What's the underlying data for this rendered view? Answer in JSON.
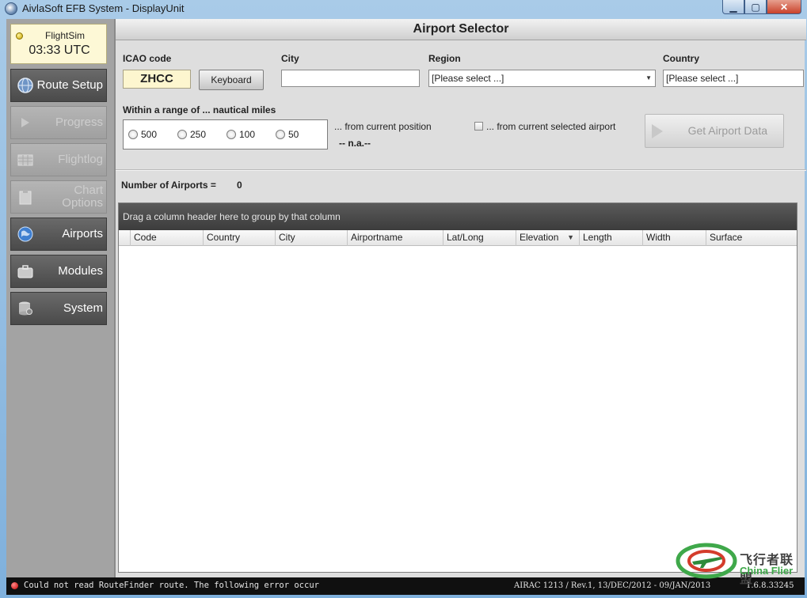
{
  "window": {
    "title": "AivlaSoft EFB System - DisplayUnit",
    "min_label": "▁",
    "max_label": "▢",
    "close_label": "✕"
  },
  "sidebar": {
    "sim_name": "FlightSim",
    "sim_time": "03:33 UTC",
    "items": [
      {
        "label": "Route Setup",
        "enabled": true,
        "icon": "globe-icon"
      },
      {
        "label": "Progress",
        "enabled": false,
        "icon": "play-icon"
      },
      {
        "label": "Flightlog",
        "enabled": false,
        "icon": "grid-icon"
      },
      {
        "label": "Chart Options",
        "enabled": false,
        "icon": "clipboard-icon"
      },
      {
        "label": "Airports",
        "enabled": true,
        "icon": "earth-icon"
      },
      {
        "label": "Modules",
        "enabled": true,
        "icon": "briefcase-icon"
      },
      {
        "label": "System",
        "enabled": true,
        "icon": "database-icon"
      }
    ]
  },
  "main": {
    "title": "Airport Selector",
    "icao_label": "ICAO code",
    "icao_value": "ZHCC",
    "keyboard_label": "Keyboard",
    "city_label": "City",
    "city_value": "",
    "region_label": "Region",
    "region_value": "[Please select ...]",
    "country_label": "Country",
    "country_value": "[Please select ...]",
    "range_label": "Within a range of ... nautical miles",
    "range_options": [
      "500",
      "250",
      "100",
      "50"
    ],
    "from_position_label": "... from current position",
    "position_value": "-- n.a.--",
    "from_airport_label": "... from current selected airport",
    "get_data_label": "Get Airport Data",
    "num_airports_label": "Number of Airports =",
    "num_airports_value": "0"
  },
  "grid": {
    "group_hint": "Drag a column header here to group by that column",
    "columns": [
      "Code",
      "Country",
      "City",
      "Airportname",
      "Lat/Long",
      "Elevation",
      "Length",
      "Width",
      "Surface"
    ],
    "sort_indicator": "▼"
  },
  "status": {
    "message": "Could not read RouteFinder route. The following error occur",
    "airac": "AIRAC 1213 / Rev.1, 13/DEC/2012 - 09/JAN/2013",
    "version": "1.6.8.33245"
  },
  "watermark": {
    "cn": "飞行者联盟",
    "en": "China Flier"
  },
  "colors": {
    "status_led": "#c30000",
    "sim_led": "#c7a100",
    "icao_bg": "#fdf6cf"
  }
}
